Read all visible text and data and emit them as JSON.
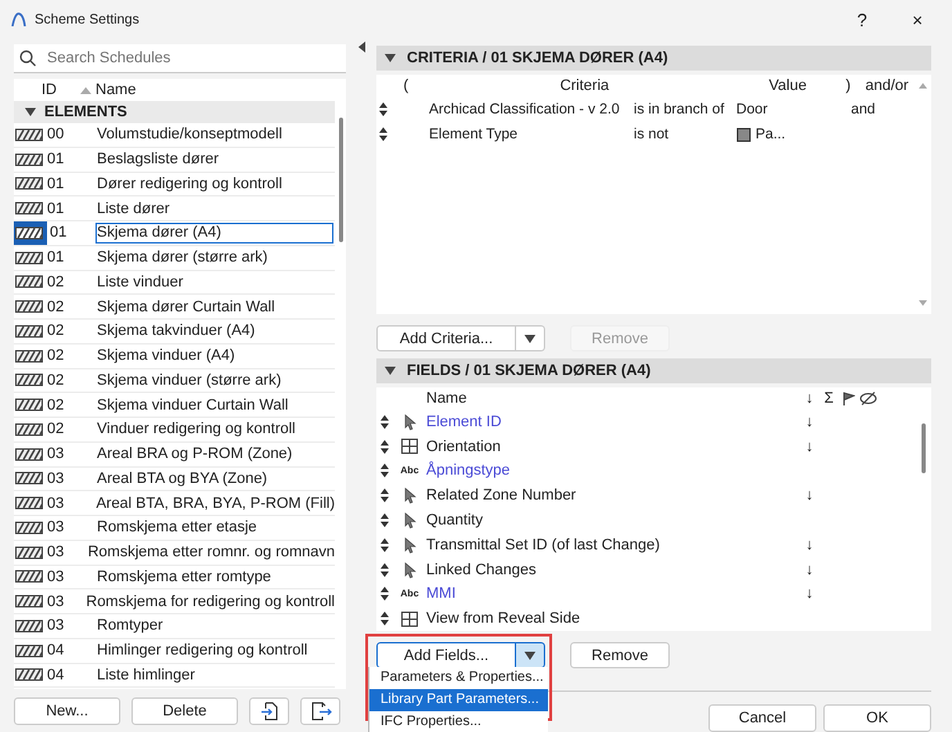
{
  "window": {
    "title": "Scheme Settings",
    "help": "?",
    "close": "×"
  },
  "search": {
    "placeholder": "Search Schedules"
  },
  "list": {
    "columns": [
      "ID",
      "Name"
    ],
    "group": {
      "label": "ELEMENTS",
      "expanded": true
    },
    "rows": [
      {
        "id": "00",
        "name": "Volumstudie/konseptmodell",
        "selected": false
      },
      {
        "id": "01",
        "name": "Beslagsliste dører",
        "selected": false
      },
      {
        "id": "01",
        "name": "Dører redigering og kontroll",
        "selected": false
      },
      {
        "id": "01",
        "name": "Liste dører",
        "selected": false
      },
      {
        "id": "01",
        "name": "Skjema dører (A4)",
        "selected": true
      },
      {
        "id": "01",
        "name": "Skjema dører (større ark)",
        "selected": false
      },
      {
        "id": "02",
        "name": "Liste vinduer",
        "selected": false
      },
      {
        "id": "02",
        "name": "Skjema dører Curtain Wall",
        "selected": false
      },
      {
        "id": "02",
        "name": "Skjema takvinduer (A4)",
        "selected": false
      },
      {
        "id": "02",
        "name": "Skjema vinduer (A4)",
        "selected": false
      },
      {
        "id": "02",
        "name": "Skjema vinduer (større ark)",
        "selected": false
      },
      {
        "id": "02",
        "name": "Skjema vinduer Curtain Wall",
        "selected": false
      },
      {
        "id": "02",
        "name": "Vinduer redigering og kontroll",
        "selected": false
      },
      {
        "id": "03",
        "name": "Areal BRA og P-ROM (Zone)",
        "selected": false
      },
      {
        "id": "03",
        "name": "Areal BTA og BYA (Zone)",
        "selected": false
      },
      {
        "id": "03",
        "name": "Areal BTA, BRA, BYA, P-ROM (Fill)",
        "selected": false
      },
      {
        "id": "03",
        "name": "Romskjema etter etasje",
        "selected": false
      },
      {
        "id": "03",
        "name": "Romskjema etter romnr. og romnavn",
        "selected": false
      },
      {
        "id": "03",
        "name": "Romskjema etter romtype",
        "selected": false
      },
      {
        "id": "03",
        "name": "Romskjema for redigering og kontroll",
        "selected": false
      },
      {
        "id": "03",
        "name": "Romtyper",
        "selected": false
      },
      {
        "id": "04",
        "name": "Himlinger redigering og kontroll",
        "selected": false
      },
      {
        "id": "04",
        "name": "Liste himlinger",
        "selected": false
      }
    ]
  },
  "list_buttons": [
    "New...",
    "Delete"
  ],
  "criteria": {
    "title": "CRITERIA / 01 SKJEMA DØRER (A4)",
    "expanded": true,
    "columns": [
      "(",
      "Criteria",
      "Value",
      ")",
      "and/or"
    ],
    "rows": [
      {
        "criteria": "Archicad Classification - v 2.0",
        "operator": "is in branch of",
        "value": "Door",
        "value_icon": false,
        "andor": "and"
      },
      {
        "criteria": "Element Type",
        "operator": "is not",
        "value": "Pa...",
        "value_icon": true
      }
    ],
    "add_button": "Add Criteria...",
    "remove_button": {
      "label": "Remove",
      "disabled": true
    }
  },
  "fields": {
    "title": "FIELDS / 01 SKJEMA DØRER (A4)",
    "expanded": true,
    "columns": [
      "Name",
      "↓",
      "Σ"
    ],
    "rows": [
      {
        "kind": "pointer",
        "name": "Element ID",
        "color": "#4b4bd6",
        "sort": "↓"
      },
      {
        "kind": "grid",
        "name": "Orientation",
        "color": "#222222",
        "sort": "↓"
      },
      {
        "kind": "text",
        "label": "Abc",
        "name": "Åpningstype",
        "color": "#4b4bd6"
      },
      {
        "kind": "pointer",
        "name": "Related Zone Number",
        "color": "#222222",
        "sort": "↓"
      },
      {
        "kind": "pointer",
        "name": "Quantity",
        "color": "#222222"
      },
      {
        "kind": "pointer",
        "name": "Transmittal Set ID (of last Change)",
        "color": "#222222",
        "sort": "↓"
      },
      {
        "kind": "pointer",
        "name": "Linked Changes",
        "color": "#222222",
        "sort": "↓"
      },
      {
        "kind": "text",
        "label": "Abc",
        "name": "MMI",
        "color": "#4b4bd6",
        "sort": "↓"
      },
      {
        "kind": "grid",
        "name": "View from Reveal Side",
        "color": "#222222"
      }
    ],
    "add_button": "Add Fields...",
    "remove_button": {
      "label": "Remove",
      "disabled": false
    },
    "menu": [
      {
        "label": "Parameters & Properties...",
        "selected": false
      },
      {
        "label": "Library Part Parameters...",
        "selected": true
      },
      {
        "label": "IFC Properties...",
        "selected": false
      }
    ]
  },
  "dialog_buttons": [
    "Cancel",
    "OK"
  ]
}
